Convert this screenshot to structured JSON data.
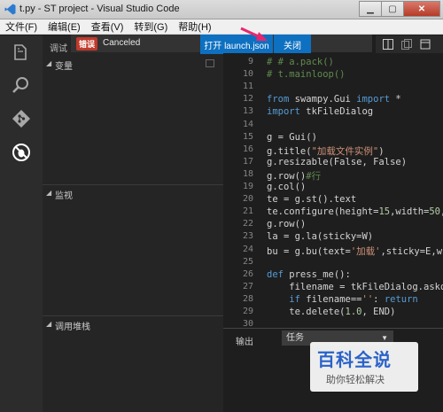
{
  "window": {
    "title": "t.py - ST project - Visual Studio Code",
    "controls": {
      "minimize": "▁",
      "maximize": "▢",
      "close": "✕"
    }
  },
  "menu": [
    "文件(F)",
    "编辑(E)",
    "查看(V)",
    "转到(G)",
    "帮助(H)"
  ],
  "activity_icons": [
    "files-icon",
    "search-icon",
    "git-icon",
    "debug-icon"
  ],
  "debug": {
    "title": "调试",
    "sections": {
      "variables": "变量",
      "watch": "监视",
      "callstack": "调用堆栈"
    }
  },
  "notification": {
    "badge": "错误",
    "message": "Canceled",
    "primary_action": "打开 launch.json",
    "close_action": "关闭"
  },
  "editor": {
    "lines": [
      {
        "n": "9",
        "parts": [
          {
            "t": "# # a.pack()",
            "c": "comment"
          }
        ]
      },
      {
        "n": "10",
        "parts": [
          {
            "t": "# t.mainloop()",
            "c": "comment"
          }
        ]
      },
      {
        "n": "11",
        "parts": []
      },
      {
        "n": "12",
        "parts": [
          {
            "t": "from",
            "c": "kw"
          },
          {
            "t": " swampy.Gui ",
            "c": "plain"
          },
          {
            "t": "import",
            "c": "kw"
          },
          {
            "t": " *",
            "c": "plain"
          }
        ]
      },
      {
        "n": "13",
        "parts": [
          {
            "t": "import",
            "c": "kw"
          },
          {
            "t": " tkFileDialog",
            "c": "plain"
          }
        ]
      },
      {
        "n": "14",
        "parts": []
      },
      {
        "n": "15",
        "parts": [
          {
            "t": "g = Gui()",
            "c": "plain"
          }
        ]
      },
      {
        "n": "16",
        "parts": [
          {
            "t": "g.title(",
            "c": "plain"
          },
          {
            "t": "\"加载文件实例\"",
            "c": "str"
          },
          {
            "t": ")",
            "c": "plain"
          }
        ]
      },
      {
        "n": "17",
        "parts": [
          {
            "t": "g.resizable(False, False)",
            "c": "plain"
          }
        ]
      },
      {
        "n": "18",
        "parts": [
          {
            "t": "g.row()",
            "c": "plain"
          },
          {
            "t": "#行",
            "c": "comment"
          }
        ]
      },
      {
        "n": "19",
        "parts": [
          {
            "t": "g.col()",
            "c": "plain"
          }
        ]
      },
      {
        "n": "20",
        "parts": [
          {
            "t": "te = g.st().text",
            "c": "plain"
          }
        ]
      },
      {
        "n": "21",
        "parts": [
          {
            "t": "te.configure(height=",
            "c": "plain"
          },
          {
            "t": "15",
            "c": "num"
          },
          {
            "t": ",width=",
            "c": "plain"
          },
          {
            "t": "50",
            "c": "num"
          },
          {
            "t": ",re",
            "c": "plain"
          }
        ]
      },
      {
        "n": "22",
        "parts": [
          {
            "t": "g.row()",
            "c": "plain"
          }
        ]
      },
      {
        "n": "23",
        "parts": [
          {
            "t": "la = g.la(sticky=W)",
            "c": "plain"
          }
        ]
      },
      {
        "n": "24",
        "parts": [
          {
            "t": "bu = g.bu(text=",
            "c": "plain"
          },
          {
            "t": "'加载'",
            "c": "str"
          },
          {
            "t": ",sticky=E,widt",
            "c": "plain"
          }
        ]
      },
      {
        "n": "25",
        "parts": []
      },
      {
        "n": "26",
        "parts": [
          {
            "t": "def",
            "c": "kw"
          },
          {
            "t": " press_me():",
            "c": "plain"
          }
        ]
      },
      {
        "n": "27",
        "parts": [
          {
            "t": "    filename = tkFileDialog.askope",
            "c": "plain"
          }
        ]
      },
      {
        "n": "28",
        "parts": [
          {
            "t": "    ",
            "c": "plain"
          },
          {
            "t": "if",
            "c": "kw"
          },
          {
            "t": " filename==",
            "c": "plain"
          },
          {
            "t": "''",
            "c": "str"
          },
          {
            "t": ": ",
            "c": "plain"
          },
          {
            "t": "return",
            "c": "kw"
          }
        ]
      },
      {
        "n": "29",
        "parts": [
          {
            "t": "    te.delete(",
            "c": "plain"
          },
          {
            "t": "1.0",
            "c": "num"
          },
          {
            "t": ", END)",
            "c": "plain"
          }
        ]
      },
      {
        "n": "30",
        "parts": []
      }
    ]
  },
  "output": {
    "label": "输出",
    "selected": "任务"
  },
  "watermark": {
    "main": "百科全说",
    "sub": "助你轻松解决"
  },
  "colors": {
    "accent": "#0e70c0",
    "error": "#c0392b"
  }
}
